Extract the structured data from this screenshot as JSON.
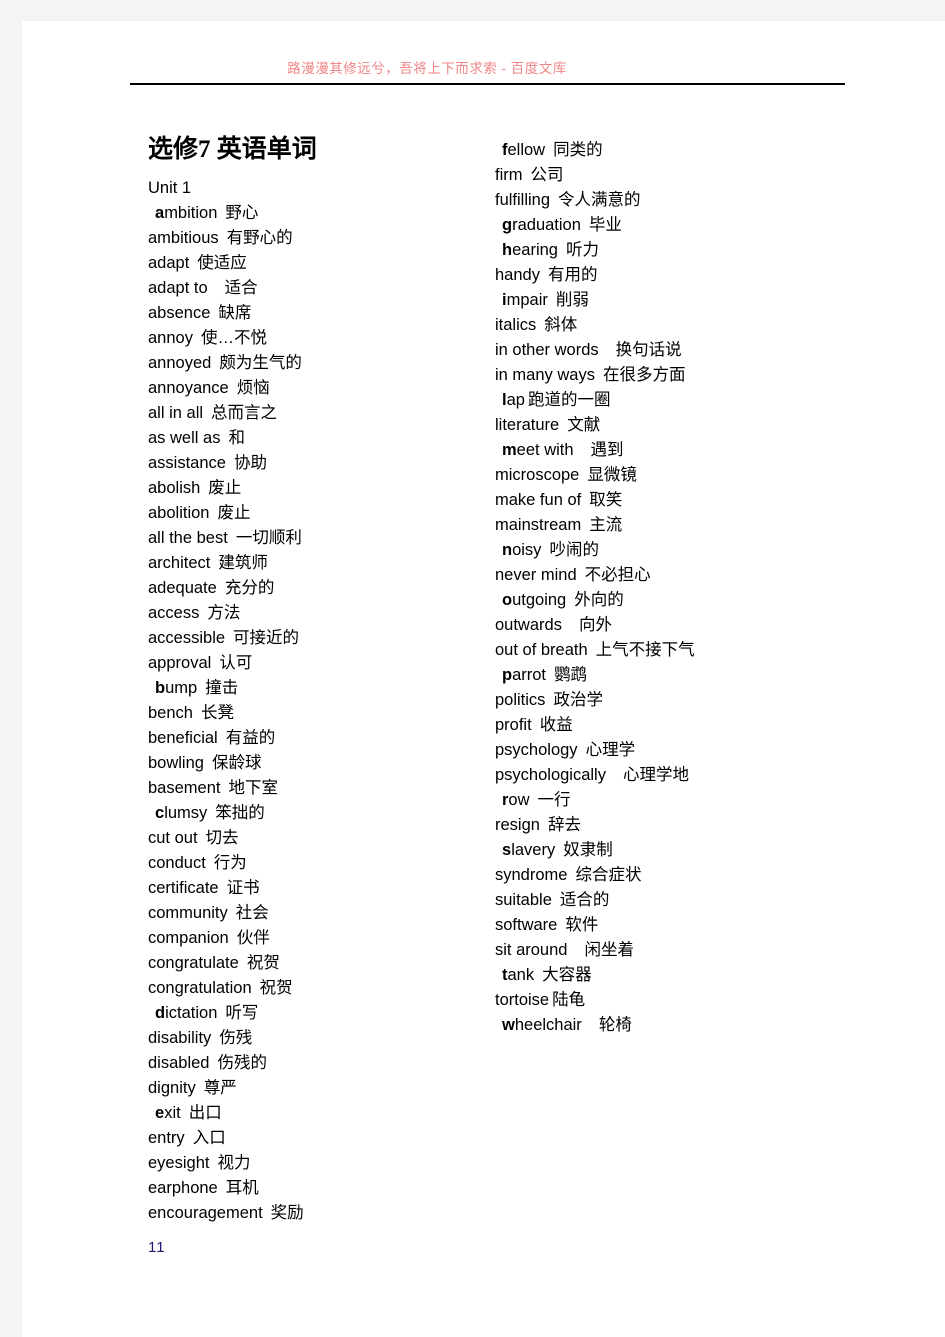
{
  "header": {
    "watermark": "路漫漫其修远兮，吾将上下而求索 - 百度文库"
  },
  "title": "选修7  英语单词",
  "unit_label": "Unit 1",
  "footer": {
    "page_number": "11"
  },
  "columns": {
    "left": [
      {
        "term": "ambition",
        "def": "野心",
        "indent": true,
        "bold_initial": 1
      },
      {
        "term": "ambitious",
        "def": "有野心的",
        "indent": false,
        "bold_initial": 0
      },
      {
        "term": "adapt",
        "def": "使适应",
        "indent": false,
        "bold_initial": 0
      },
      {
        "term": "adapt to",
        "def": "适合",
        "indent": false,
        "bold_initial": 0,
        "wide_gap": true
      },
      {
        "term": "absence",
        "def": "缺席",
        "indent": false,
        "bold_initial": 0
      },
      {
        "term": "annoy",
        "def": "使…不悦",
        "indent": false,
        "bold_initial": 0
      },
      {
        "term": "annoyed",
        "def": "颇为生气的",
        "indent": false,
        "bold_initial": 0
      },
      {
        "term": "annoyance",
        "def": "烦恼",
        "indent": false,
        "bold_initial": 0
      },
      {
        "term": "all in all",
        "def": "总而言之",
        "indent": false,
        "bold_initial": 0
      },
      {
        "term": "as well as",
        "def": "和",
        "indent": false,
        "bold_initial": 0
      },
      {
        "term": "assistance",
        "def": "协助",
        "indent": false,
        "bold_initial": 0
      },
      {
        "term": "abolish",
        "def": "废止",
        "indent": false,
        "bold_initial": 0
      },
      {
        "term": "abolition",
        "def": "废止",
        "indent": false,
        "bold_initial": 0
      },
      {
        "term": "all the best",
        "def": "一切顺利",
        "indent": false,
        "bold_initial": 0
      },
      {
        "term": "architect",
        "def": "建筑师",
        "indent": false,
        "bold_initial": 0
      },
      {
        "term": "adequate",
        "def": "充分的",
        "indent": false,
        "bold_initial": 0
      },
      {
        "term": "access",
        "def": "方法",
        "indent": false,
        "bold_initial": 0
      },
      {
        "term": "accessible",
        "def": "可接近的",
        "indent": false,
        "bold_initial": 0
      },
      {
        "term": "approval",
        "def": "认可",
        "indent": false,
        "bold_initial": 0
      },
      {
        "term": "bump",
        "def": "撞击",
        "indent": true,
        "bold_initial": 1
      },
      {
        "term": "bench",
        "def": "长凳",
        "indent": false,
        "bold_initial": 0
      },
      {
        "term": "beneficial",
        "def": "有益的",
        "indent": false,
        "bold_initial": 0
      },
      {
        "term": "bowling",
        "def": "保龄球",
        "indent": false,
        "bold_initial": 0
      },
      {
        "term": "basement",
        "def": "地下室",
        "indent": false,
        "bold_initial": 0
      },
      {
        "term": "clumsy",
        "def": "笨拙的",
        "indent": true,
        "bold_initial": 1
      },
      {
        "term": "cut out",
        "def": "切去",
        "indent": false,
        "bold_initial": 0
      },
      {
        "term": "conduct",
        "def": "行为",
        "indent": false,
        "bold_initial": 0
      },
      {
        "term": "certificate",
        "def": "证书",
        "indent": false,
        "bold_initial": 0
      },
      {
        "term": "community",
        "def": "社会",
        "indent": false,
        "bold_initial": 0
      },
      {
        "term": "companion",
        "def": "伙伴",
        "indent": false,
        "bold_initial": 0
      },
      {
        "term": "congratulate",
        "def": "祝贺",
        "indent": false,
        "bold_initial": 0
      },
      {
        "term": "congratulation",
        "def": "祝贺",
        "indent": false,
        "bold_initial": 0
      },
      {
        "term": "dictation",
        "def": "听写",
        "indent": true,
        "bold_initial": 1
      },
      {
        "term": "disability",
        "def": "伤残",
        "indent": false,
        "bold_initial": 0
      },
      {
        "term": "disabled",
        "def": "伤残的",
        "indent": false,
        "bold_initial": 0
      },
      {
        "term": "dignity",
        "def": "尊严",
        "indent": false,
        "bold_initial": 0
      },
      {
        "term": "exit",
        "def": "出口",
        "indent": true,
        "bold_initial": 1
      },
      {
        "term": "entry",
        "def": "入口",
        "indent": false,
        "bold_initial": 0
      },
      {
        "term": "eyesight",
        "def": "视力",
        "indent": false,
        "bold_initial": 0
      },
      {
        "term": "earphone",
        "def": "耳机",
        "indent": false,
        "bold_initial": 0
      },
      {
        "term": "encouragement",
        "def": "奖励",
        "indent": false,
        "bold_initial": 0
      }
    ],
    "right": [
      {
        "term": "fellow",
        "def": "同类的",
        "indent": true,
        "bold_initial": 1
      },
      {
        "term": "firm",
        "def": "公司",
        "indent": false,
        "bold_initial": 0
      },
      {
        "term": "fulfilling",
        "def": "令人满意的",
        "indent": false,
        "bold_initial": 0
      },
      {
        "term": "graduation",
        "def": "毕业",
        "indent": true,
        "bold_initial": 1
      },
      {
        "term": "hearing",
        "def": "听力",
        "indent": true,
        "bold_initial": 1
      },
      {
        "term": "handy",
        "def": "有用的",
        "indent": false,
        "bold_initial": 0
      },
      {
        "term": "impair",
        "def": "削弱",
        "indent": true,
        "bold_initial": 1
      },
      {
        "term": "italics",
        "def": "斜体",
        "indent": false,
        "bold_initial": 0
      },
      {
        "term": "in other words",
        "def": "换句话说",
        "indent": false,
        "bold_initial": 0,
        "wide_gap": true
      },
      {
        "term": "in many ways",
        "def": "在很多方面",
        "indent": false,
        "bold_initial": 0
      },
      {
        "term": "lap",
        "def": "跑道的一圈",
        "indent": true,
        "bold_initial": 1,
        "tight_gap": true
      },
      {
        "term": "literature",
        "def": "文献",
        "indent": false,
        "bold_initial": 0
      },
      {
        "term": "meet with",
        "def": "遇到",
        "indent": true,
        "bold_initial": 1,
        "wide_gap": true
      },
      {
        "term": "microscope",
        "def": "显微镜",
        "indent": false,
        "bold_initial": 0
      },
      {
        "term": "make fun of",
        "def": "取笑",
        "indent": false,
        "bold_initial": 0
      },
      {
        "term": "mainstream",
        "def": "主流",
        "indent": false,
        "bold_initial": 0
      },
      {
        "term": "noisy",
        "def": "吵闹的",
        "indent": true,
        "bold_initial": 1
      },
      {
        "term": "never mind",
        "def": "不必担心",
        "indent": false,
        "bold_initial": 0
      },
      {
        "term": "outgoing",
        "def": "外向的",
        "indent": true,
        "bold_initial": 1
      },
      {
        "term": "outwards",
        "def": "向外",
        "indent": false,
        "bold_initial": 0,
        "wide_gap": true
      },
      {
        "term": "out of breath",
        "def": "上气不接下气",
        "indent": false,
        "bold_initial": 0
      },
      {
        "term": "parrot",
        "def": "鹦鹉",
        "indent": true,
        "bold_initial": 1
      },
      {
        "term": "politics",
        "def": "政治学",
        "indent": false,
        "bold_initial": 0
      },
      {
        "term": "profit",
        "def": "收益",
        "indent": false,
        "bold_initial": 0
      },
      {
        "term": "psychology",
        "def": "心理学",
        "indent": false,
        "bold_initial": 0
      },
      {
        "term": "psychologically",
        "def": "心理学地",
        "indent": false,
        "bold_initial": 0,
        "wide_gap": true
      },
      {
        "term": "row",
        "def": "一行",
        "indent": true,
        "bold_initial": 1
      },
      {
        "term": "resign",
        "def": "辞去",
        "indent": false,
        "bold_initial": 0
      },
      {
        "term": "slavery",
        "def": "奴隶制",
        "indent": true,
        "bold_initial": 1
      },
      {
        "term": "syndrome",
        "def": "综合症状",
        "indent": false,
        "bold_initial": 0
      },
      {
        "term": "suitable",
        "def": "适合的",
        "indent": false,
        "bold_initial": 0
      },
      {
        "term": "software",
        "def": "软件",
        "indent": false,
        "bold_initial": 0
      },
      {
        "term": "sit around",
        "def": "闲坐着",
        "indent": false,
        "bold_initial": 0,
        "wide_gap": true
      },
      {
        "term": "tank",
        "def": "大容器",
        "indent": true,
        "bold_initial": 1
      },
      {
        "term": "tortoise",
        "def": "陆龟",
        "indent": false,
        "bold_initial": 0,
        "tight_gap": true
      },
      {
        "term": "wheelchair",
        "def": "轮椅",
        "indent": true,
        "bold_initial": 1,
        "wide_gap": true
      }
    ]
  }
}
